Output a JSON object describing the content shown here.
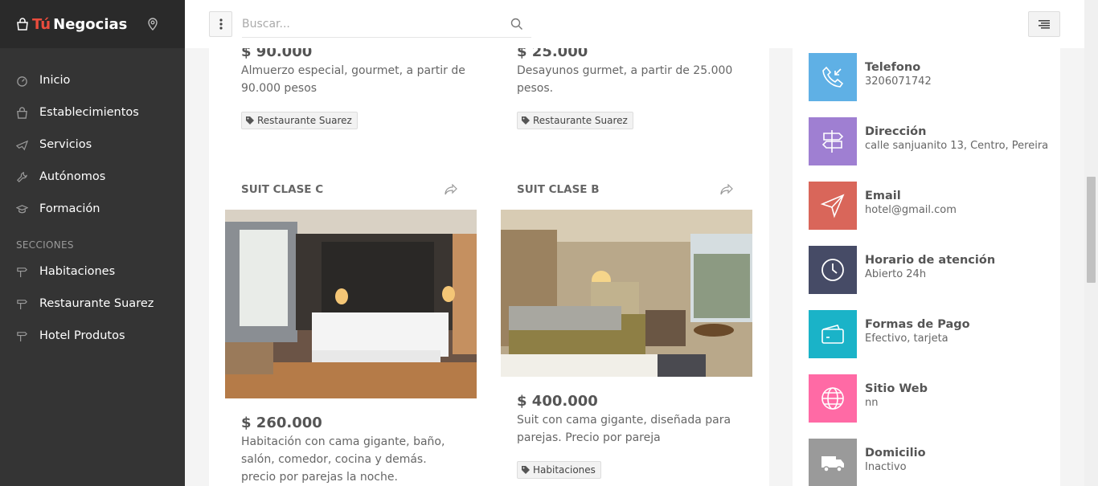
{
  "brand": {
    "tu": "Tú",
    "name": "Negocias"
  },
  "nav": {
    "items": [
      {
        "label": "Inicio",
        "icon": "dashboard-icon"
      },
      {
        "label": "Establecimientos",
        "icon": "bag-icon"
      },
      {
        "label": "Servicios",
        "icon": "plane-icon"
      },
      {
        "label": "Autónomos",
        "icon": "wrench-icon"
      },
      {
        "label": "Formación",
        "icon": "graduation-cap-icon"
      }
    ],
    "section_label": "SECCIONES",
    "sections": [
      {
        "label": "Habitaciones",
        "icon": "signpost-icon"
      },
      {
        "label": "Restaurante Suarez",
        "icon": "signpost-icon"
      },
      {
        "label": "Hotel Produtos",
        "icon": "signpost-icon"
      }
    ]
  },
  "search": {
    "placeholder": "Buscar..."
  },
  "cards": [
    {
      "price": "$ 90.000",
      "description": "Almuerzo especial, gourmet, a partir de 90.000 pesos",
      "tag": "Restaurante Suarez"
    },
    {
      "price": "$ 25.000",
      "description": "Desayunos gurmet, a partir de 25.000 pesos.",
      "tag": "Restaurante Suarez"
    },
    {
      "title": "SUIT CLASE C",
      "price": "$ 260.000",
      "description": "Habitación con cama gigante, baño, salón, comedor, cocina y demás. precio por parejas la noche."
    },
    {
      "title": "SUIT CLASE B",
      "price": "$ 400.000",
      "description": "Suit con cama gigante, diseñada para parejas. Precio por pareja",
      "tag": "Habitaciones"
    }
  ],
  "contacts": [
    {
      "title": "Telefono",
      "value": "3206071742",
      "color": "#5fb0e5",
      "icon": "phone-incoming-icon"
    },
    {
      "title": "Dirección",
      "value": "calle sanjuanito 13, Centro, Pereira",
      "color": "#9f7fd2",
      "icon": "signpost-icon"
    },
    {
      "title": "Email",
      "value": "hotel@gmail.com",
      "color": "#d9665a",
      "icon": "send-icon"
    },
    {
      "title": "Horario de atención",
      "value": "Abierto 24h",
      "color": "#464b66",
      "icon": "clock-icon"
    },
    {
      "title": "Formas de Pago",
      "value": "Efectivo, tarjeta",
      "color": "#1ab3c8",
      "icon": "wallet-icon"
    },
    {
      "title": "Sitio Web",
      "value": "nn",
      "color": "#ff6aa5",
      "icon": "globe-icon"
    },
    {
      "title": "Domicilio",
      "value": "Inactivo",
      "color": "#9a9a9a",
      "icon": "truck-icon"
    }
  ]
}
